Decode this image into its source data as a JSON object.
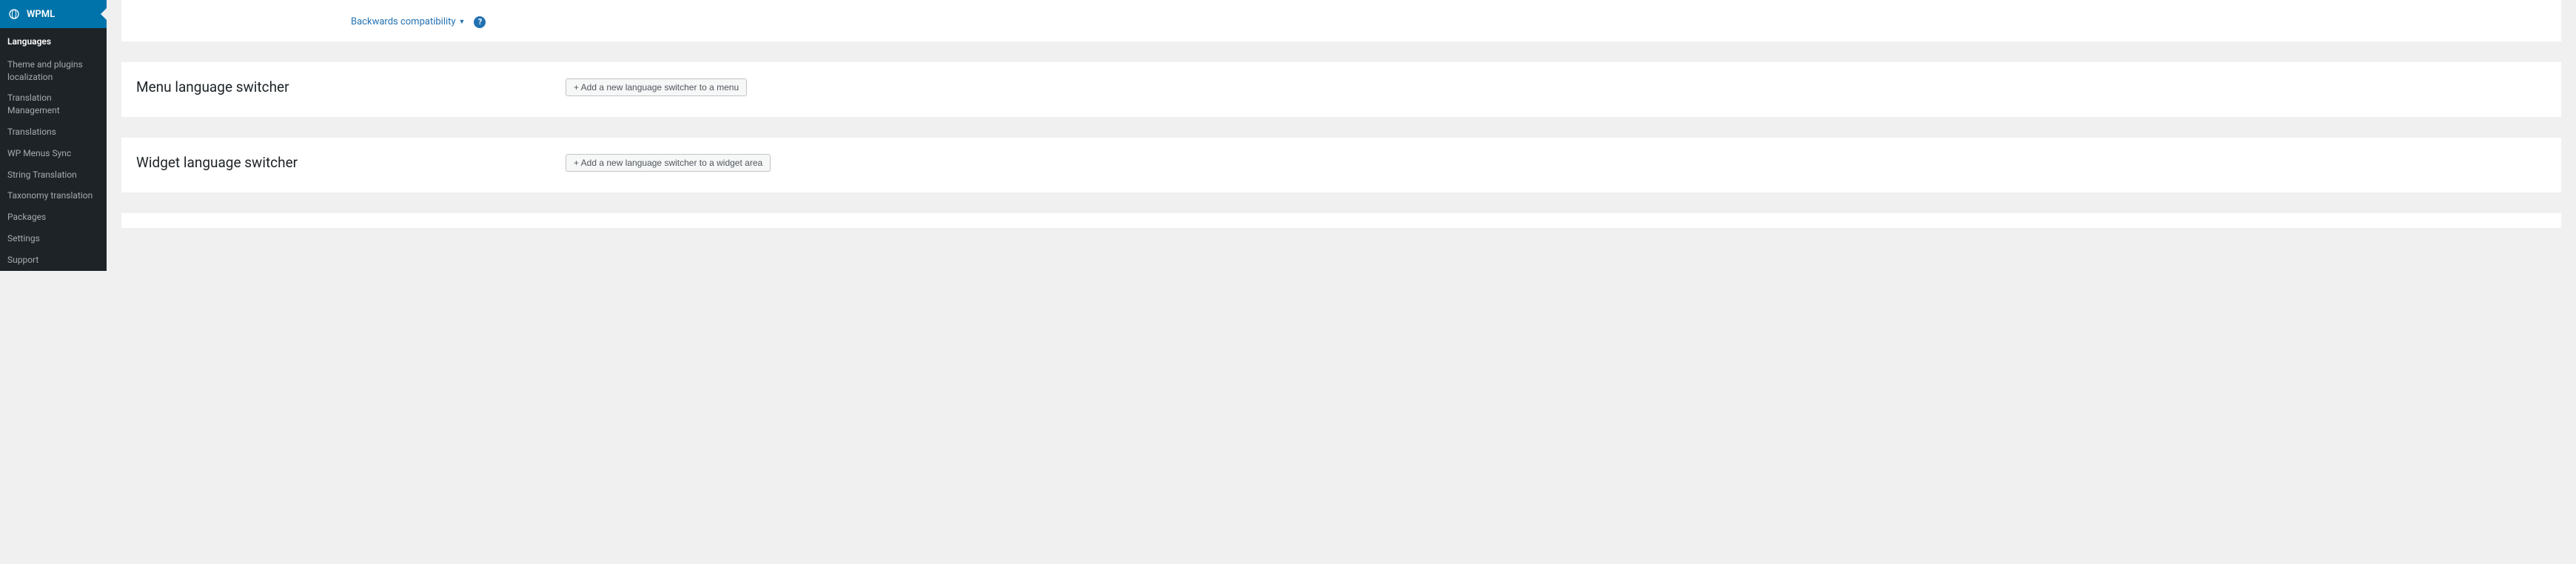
{
  "sidebar": {
    "header": "WPML",
    "items": [
      {
        "label": "Languages",
        "active": true
      },
      {
        "label": "Theme and plugins localization",
        "active": false
      },
      {
        "label": "Translation Management",
        "active": false
      },
      {
        "label": "Translations",
        "active": false
      },
      {
        "label": "WP Menus Sync",
        "active": false
      },
      {
        "label": "String Translation",
        "active": false
      },
      {
        "label": "Taxonomy translation",
        "active": false
      },
      {
        "label": "Packages",
        "active": false
      },
      {
        "label": "Settings",
        "active": false
      },
      {
        "label": "Support",
        "active": false
      }
    ]
  },
  "top": {
    "link_text": "Backwards compatibility",
    "help_glyph": "?"
  },
  "panels": [
    {
      "title": "Menu language switcher",
      "button": "+ Add a new language switcher to a menu"
    },
    {
      "title": "Widget language switcher",
      "button": "+ Add a new language switcher to a widget area"
    }
  ]
}
